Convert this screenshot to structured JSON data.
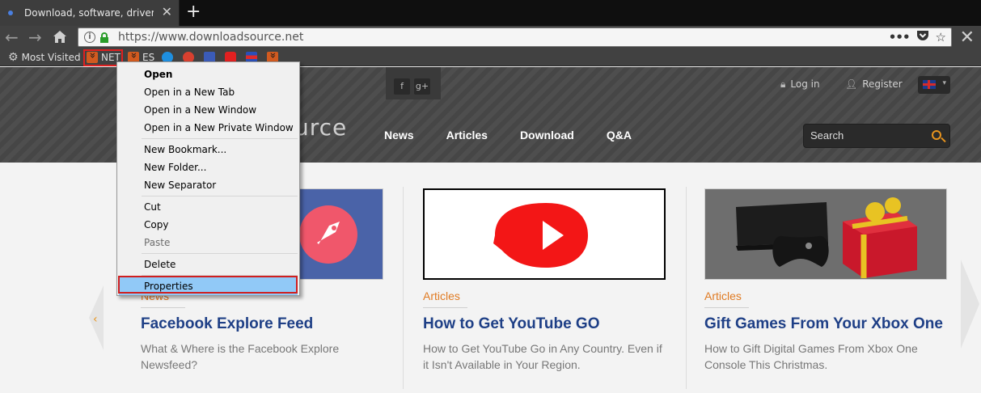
{
  "browser": {
    "tab_title": "Download, software, drivers, ga",
    "url": "https://www.downloadsource.net",
    "bookmarks": [
      {
        "label": "Most Visited"
      },
      {
        "label": "NET"
      },
      {
        "label": "ES"
      }
    ]
  },
  "site": {
    "logo_tail": "urce",
    "nav": [
      "News",
      "Articles",
      "Download",
      "Q&A"
    ],
    "login": "Log in",
    "register": "Register",
    "search_placeholder": "Search",
    "social": [
      "f",
      "g+"
    ]
  },
  "cards": [
    {
      "category": "News",
      "title": "Facebook Explore Feed",
      "desc": "What & Where is the Facebook Explore Newsfeed?"
    },
    {
      "category": "Articles",
      "title": "How to Get YouTube GO",
      "desc": "How to Get YouTube Go in Any Country. Even if it Isn't Available in Your Region."
    },
    {
      "category": "Articles",
      "title": "Gift Games From Your Xbox One",
      "desc": "How to Gift Digital Games From Xbox One Console This Christmas."
    }
  ],
  "context_menu": {
    "items": [
      {
        "label": "Open",
        "bold": true
      },
      {
        "label": "Open in a New Tab"
      },
      {
        "label": "Open in a New Window"
      },
      {
        "label": "Open in a New Private Window"
      },
      {
        "sep": true
      },
      {
        "label": "New Bookmark..."
      },
      {
        "label": "New Folder..."
      },
      {
        "label": "New Separator"
      },
      {
        "sep": true
      },
      {
        "label": "Cut"
      },
      {
        "label": "Copy"
      },
      {
        "label": "Paste",
        "disabled": true
      },
      {
        "sep": true
      },
      {
        "label": "Delete"
      },
      {
        "sep": true
      },
      {
        "label": "Properties",
        "selected": true
      }
    ]
  },
  "colors": {
    "accent": "#e07b23",
    "title": "#1e3f86",
    "menu_highlight": "#91c9f7",
    "marker": "#d01f1f"
  }
}
